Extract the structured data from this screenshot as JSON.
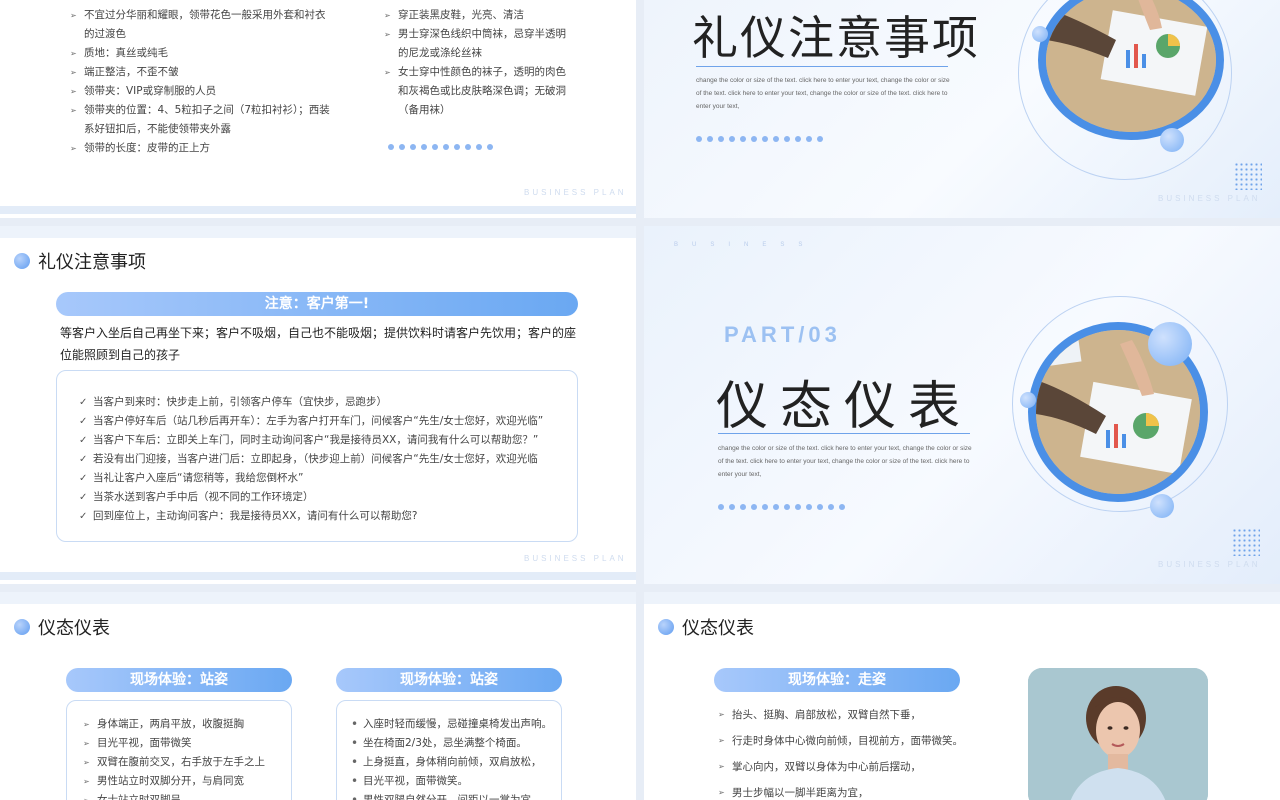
{
  "slide1": {
    "left_items": [
      "不宜过分华丽和耀眼，领带花色一般采用外套和衬衣的过渡色",
      "质地：真丝或纯毛",
      "端正整洁，不歪不皱",
      "领带夹：VIP或穿制服的人员",
      "领带夹的位置：4、5粒扣子之间（7粒扣衬衫）；西装系好钮扣后，不能使领带夹外露",
      "领带的长度：皮带的正上方"
    ],
    "right_items": [
      "穿正装黑皮鞋，光亮、清洁",
      "男士穿深色线织中筒袜，忌穿半透明的尼龙或涤纶丝袜",
      "女士穿中性颜色的袜子，透明的肉色和灰褐色或比皮肤略深色调；无破洞（备用袜）"
    ],
    "watermark": "BUSINESS  PLAN"
  },
  "slide2": {
    "title": "礼仪注意事项",
    "body": "change the color or size of the text. click here to enter your text, change the color or size of the text. click here to enter your text, change the color or size of the text. click here to enter your text,",
    "watermark": "BUSINESS  PLAN"
  },
  "slide3": {
    "heading": "礼仪注意事项",
    "pill": "注意：客户第一!",
    "intro": "等客户入坐后自己再坐下来；客户不吸烟，自己也不能吸烟；提供饮料时请客户先饮用；客户的座位能照顾到自己的孩子",
    "items": [
      "当客户到来时：快步走上前，引领客户停车（宜快步，忌跑步）",
      "当客户停好车后（站几秒后再开车）：左手为客户打开车门，问候客户“先生/女士您好，欢迎光临”",
      "当客户下车后：立即关上车门，同时主动询问客户“我是接待员XX，请问我有什么可以帮助您？”",
      "若没有出门迎接，当客户进门后：立即起身，（快步迎上前）问候客户“先生/女士您好，欢迎光临",
      "当礼让客户入座后“请您稍等，我给您倒杯水”",
      "当茶水送到客户手中后（视不同的工作环境定）",
      "回到座位上，主动询问客户：我是接待员XX，请问有什么可以帮助您?"
    ],
    "watermark": "BUSINESS  PLAN"
  },
  "slide4": {
    "top_chars": [
      "B",
      "U",
      "S",
      "I",
      "N",
      "E",
      "S",
      "S"
    ],
    "part": "PART/03",
    "title": "仪态仪表",
    "body": "change the color or size of the text. click here to enter your text, change the color or size of the text. click here to enter your text, change the color or size of the text. click here to enter your text,",
    "watermark": "BUSINESS  PLAN"
  },
  "slide5": {
    "heading": "仪态仪表",
    "left_pill": "现场体验：站姿",
    "left_items": [
      "身体端正，两肩平放，收腹挺胸",
      "目光平视，面带微笑",
      "双臂在腹前交叉，右手放于左手之上",
      "男性站立时双脚分开，与肩同宽",
      "女士站立时双脚呈"
    ],
    "right_pill": "现场体验：站姿",
    "right_items": [
      "入座时轻而缓慢，忌碰撞桌椅发出声响。",
      "坐在椅面2/3处，忌坐满整个椅面。",
      "上身挺直，身体稍向前倾，双肩放松，",
      "目光平视，面带微笑。",
      "男性双腿自然分开，间距以一掌为宜。"
    ]
  },
  "slide6": {
    "heading": "仪态仪表",
    "pill": "现场体验：走姿",
    "items": [
      "抬头、挺胸、肩部放松，双臂自然下垂，",
      "行走时身体中心微向前倾，目视前方，面带微笑。",
      "掌心向内，双臂以身体为中心前后摆动，",
      "男士步幅以一脚半距离为宜，"
    ]
  }
}
